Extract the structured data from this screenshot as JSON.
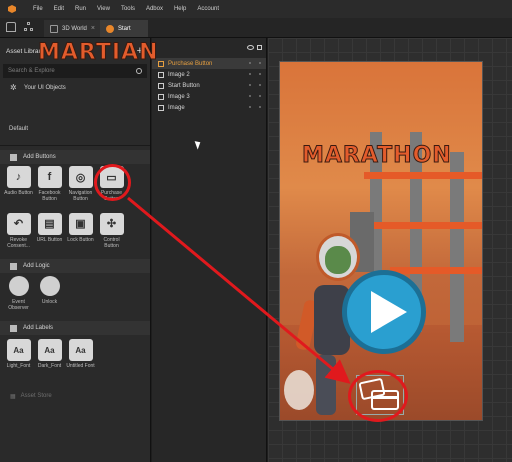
{
  "menubar": {
    "items": [
      "File",
      "Edit",
      "Run",
      "View",
      "Tools",
      "Adbox",
      "Help",
      "Account"
    ]
  },
  "tabs": [
    {
      "label": "3D World"
    },
    {
      "label": "Start"
    }
  ],
  "asset_library": {
    "title": "Asset Library",
    "search_placeholder": "Search & Explore",
    "your_ui_objects": "Your UI Objects",
    "default_label": "Default",
    "sections": {
      "buttons": "Add Buttons",
      "logic": "Add Logic",
      "labels": "Add Labels"
    },
    "buttons": [
      {
        "label": "Audio Button",
        "icon": "speaker-icon"
      },
      {
        "label": "Facebook Button",
        "icon": "facebook-icon"
      },
      {
        "label": "Navigation Button",
        "icon": "compass-icon"
      },
      {
        "label": "Purchase Button",
        "icon": "credit-card-icon"
      },
      {
        "label": "Revoke Consent...",
        "icon": "undo-icon"
      },
      {
        "label": "URL Button",
        "icon": "document-icon"
      },
      {
        "label": "Lock Button",
        "icon": "lock-icon"
      },
      {
        "label": "Control Button",
        "icon": "gamepad-icon"
      }
    ],
    "logic": [
      {
        "label": "Event Observer",
        "icon": "eye-icon"
      },
      {
        "label": "Unlock",
        "icon": "unlock-icon"
      }
    ],
    "labels": [
      {
        "label": "Light_Font",
        "glyph": "Aa"
      },
      {
        "label": "Dark_Font",
        "glyph": "Aa"
      },
      {
        "label": "Untitled Font",
        "glyph": "Aa"
      }
    ],
    "asset_store": "Asset Store"
  },
  "hierarchy": {
    "items": [
      {
        "label": "Purchase Button",
        "selected": true
      },
      {
        "label": "Image 2",
        "selected": false
      },
      {
        "label": "Start Button",
        "selected": false
      },
      {
        "label": "Image 3",
        "selected": false
      },
      {
        "label": "Image",
        "selected": false
      }
    ]
  },
  "canvas": {
    "title_line1": "MARTIAN",
    "title_line2": "MARATHON"
  },
  "colors": {
    "accent": "#e8862a",
    "annotation": "#e0191d",
    "selected_text": "#e8a040"
  }
}
